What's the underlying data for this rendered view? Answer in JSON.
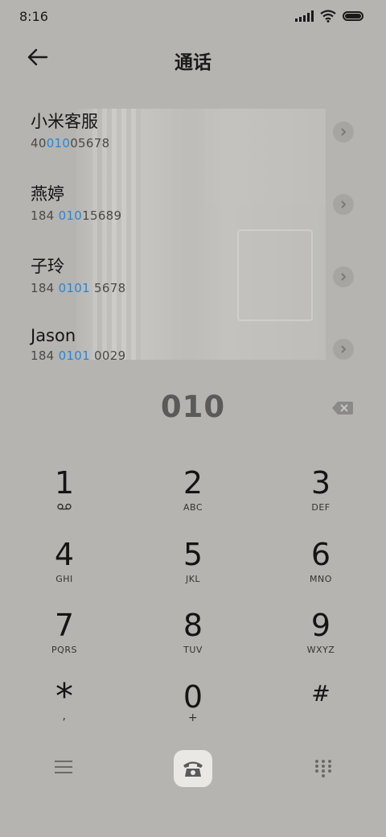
{
  "status": {
    "time": "8:16"
  },
  "header": {
    "title": "通话"
  },
  "contacts": [
    {
      "name": "小米客服",
      "pre": "40",
      "hl": "010",
      "post": "05678"
    },
    {
      "name": "燕婷",
      "pre": "184 ",
      "hl": "010",
      "post": "15689"
    },
    {
      "name": "子玲",
      "pre": "184 ",
      "hl": "0101",
      "post": " 5678"
    },
    {
      "name": "Jason",
      "pre": "184 ",
      "hl": "0101",
      "post": " 0029"
    }
  ],
  "dial_input": {
    "value": "010"
  },
  "keys": [
    {
      "digit": "1",
      "letters": ""
    },
    {
      "digit": "2",
      "letters": "ABC"
    },
    {
      "digit": "3",
      "letters": "DEF"
    },
    {
      "digit": "4",
      "letters": "GHI"
    },
    {
      "digit": "5",
      "letters": "JKL"
    },
    {
      "digit": "6",
      "letters": "MNO"
    },
    {
      "digit": "7",
      "letters": "PQRS"
    },
    {
      "digit": "8",
      "letters": "TUV"
    },
    {
      "digit": "9",
      "letters": "WXYZ"
    },
    {
      "digit": "*",
      "letters": ","
    },
    {
      "digit": "0",
      "letters": "+"
    },
    {
      "digit": "#",
      "letters": ""
    }
  ],
  "icons": {
    "back": "arrow-left-icon",
    "backspace": "backspace-icon",
    "voicemail": "voicemail-icon",
    "menu": "menu-icon",
    "call": "phone-icon",
    "dialpad": "dialpad-icon"
  },
  "colors": {
    "highlight": "#2a84d6",
    "background": "#b5b4b0"
  }
}
